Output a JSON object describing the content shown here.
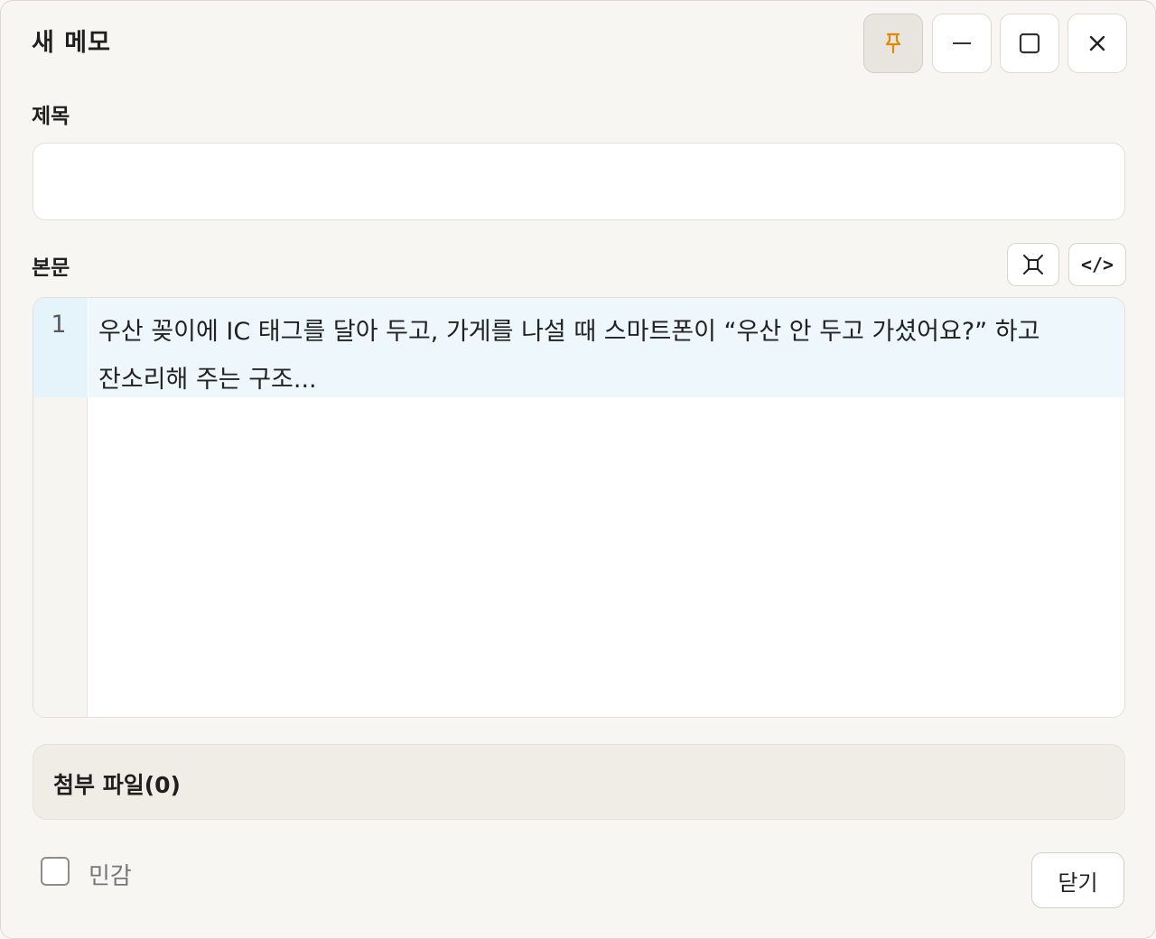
{
  "window": {
    "title": "새 메모",
    "controls": {
      "pin_icon": "pin-icon",
      "minimize_icon": "minimize-icon",
      "maximize_icon": "maximize-icon",
      "close_icon": "close-icon",
      "pin_color": "#e08a00"
    }
  },
  "form": {
    "title_label": "제목",
    "title_value": "",
    "body_label": "본문",
    "toolbar": {
      "expand_icon": "expand-icon",
      "code_label": "</>"
    },
    "editor": {
      "line_numbers": [
        "1"
      ],
      "lines": [
        "우산 꽂이에 IC 태그를 달아 두고, 가게를 나설 때 스마트폰이 “우산 안 두고 가셨어요?” 하고 잔소리해 주는 구조..."
      ]
    }
  },
  "attachments": {
    "label": "첨부 파일(0)"
  },
  "footer": {
    "sensitive_label": "민감",
    "sensitive_checked": false,
    "close_label": "닫기"
  }
}
